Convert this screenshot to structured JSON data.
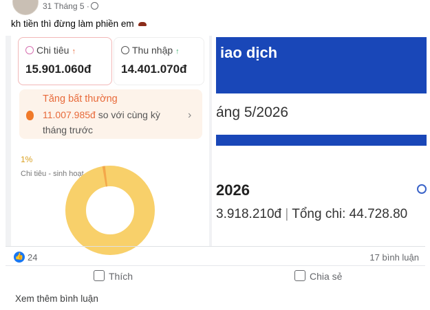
{
  "post": {
    "date": "31 Tháng 5 ·",
    "text": "kh tiền thì đừng làm phiền em"
  },
  "left_screenshot": {
    "spend_label": "Chi tiêu",
    "spend_arrow": "↑",
    "spend_value": "15.901.060đ",
    "income_label": "Thu nhập",
    "income_arrow": "↑",
    "income_value": "14.401.070đ",
    "alert_title": "Tăng bất thường",
    "alert_amount": "11.007.985đ",
    "alert_rest": "so với cùng kỳ",
    "alert_line2": "tháng trước",
    "chevron": "›",
    "percent": "1%",
    "category": "Chi tiêu - sinh hoạt",
    "donut_share": 0.99
  },
  "right_screenshot": {
    "header": "iao dịch",
    "month": "áng 5/2026",
    "year": "2026",
    "income_part": "3.918.210đ",
    "separator": "|",
    "total_label": "Tổng chi: 44.728.80"
  },
  "reactions": {
    "like_count": "24",
    "comments": "17 bình luận"
  },
  "actions": {
    "like": "Thích",
    "share": "Chia sẻ"
  },
  "more_comments": "Xem thêm bình luận",
  "colors": {
    "brand_blue": "#1947b8",
    "fb_blue": "#1877f2",
    "alert_orange": "#e86a3a",
    "donut_yellow": "#f8d06a"
  }
}
